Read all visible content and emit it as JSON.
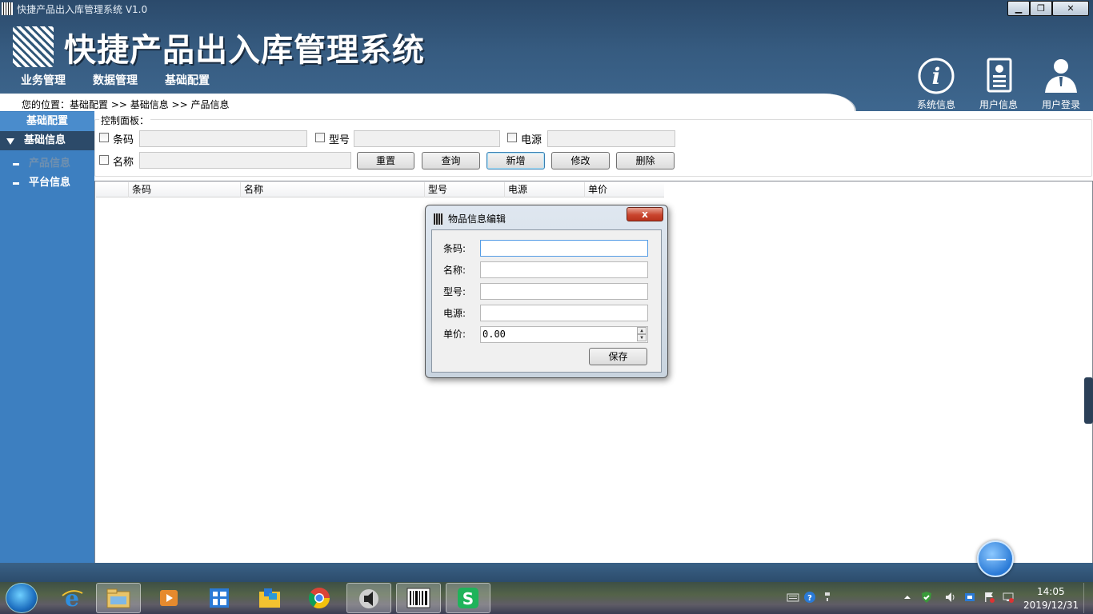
{
  "window": {
    "title": "快捷产品出入库管理系统 V1.0",
    "min_glyph": "▁",
    "max_glyph": "❐",
    "close_glyph": "✕"
  },
  "header": {
    "app_title": "快捷产品出入库管理系统",
    "menu": [
      "业务管理",
      "数据管理",
      "基础配置"
    ],
    "icons": [
      {
        "label": "系统信息",
        "icon": "info-icon"
      },
      {
        "label": "用户信息",
        "icon": "user-card-icon"
      },
      {
        "label": "用户登录",
        "icon": "user-login-icon"
      }
    ]
  },
  "breadcrumb": "您的位置：基础配置 >> 基础信息 >> 产品信息",
  "sidebar": {
    "group1": "基础配置",
    "group2": "基础信息",
    "items": [
      "产品信息",
      "平台信息"
    ]
  },
  "control_panel": {
    "legend": "控制面板：",
    "filters": {
      "barcode_label": "条码",
      "model_label": "型号",
      "power_label": "电源",
      "name_label": "名称"
    },
    "buttons": {
      "reset": "重置",
      "query": "查询",
      "add": "新增",
      "edit": "修改",
      "delete": "删除"
    }
  },
  "table": {
    "columns": [
      "",
      "条码",
      "名称",
      "型号",
      "电源",
      "单价"
    ]
  },
  "dialog": {
    "title": "物品信息编辑",
    "close_glyph": "x",
    "fields": {
      "barcode_label": "条码:",
      "barcode_value": "",
      "name_label": "名称:",
      "name_value": "",
      "model_label": "型号:",
      "model_value": "",
      "power_label": "电源:",
      "power_value": "",
      "price_label": "单价:",
      "price_value": "0.00"
    },
    "save_label": "保存"
  },
  "taskbar": {
    "time": "14:05",
    "date": "2019/12/31"
  },
  "colors": {
    "header": "#365b80",
    "sidebar": "#3d7fc0",
    "sidebar_selected": "#2c4a69",
    "dialog_close": "#c9452e"
  }
}
